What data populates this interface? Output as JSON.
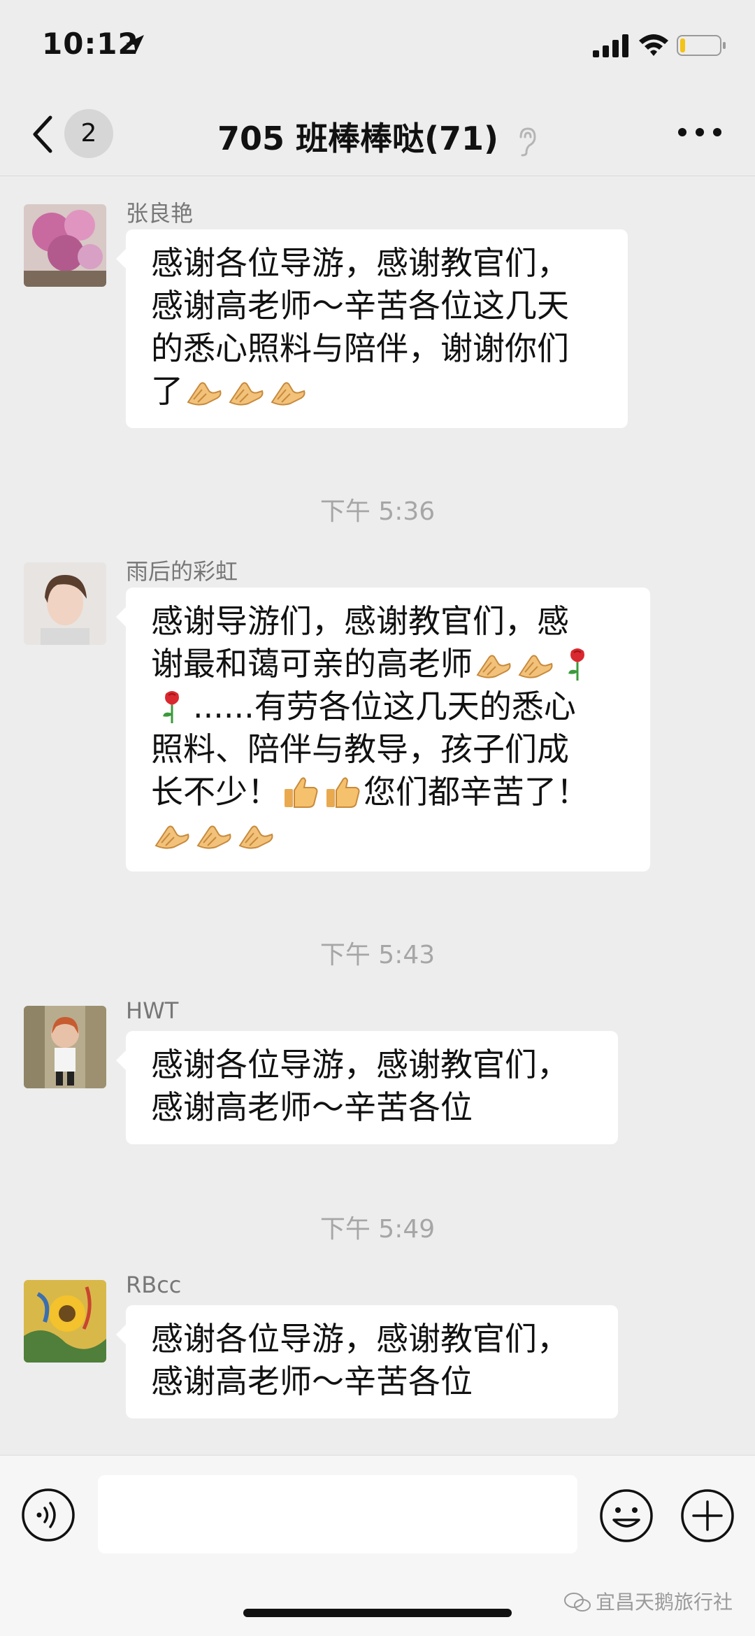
{
  "status_bar": {
    "time": "10:12"
  },
  "nav": {
    "back_count": "2",
    "title": "705 班棒棒哒(71)"
  },
  "messages": [
    {
      "sender": "张良艳",
      "lines": [
        "感谢各位导游，感谢教官们，",
        "感谢高老师～辛苦各位这几天",
        "的悉心照料与陪伴，谢谢你们",
        "了"
      ]
    },
    {
      "timestamp": "下午 5:36"
    },
    {
      "sender": "雨后的彩虹",
      "lines": [
        "感谢导游们，感谢教官们，感",
        "谢最和蔼可亲的高老师",
        "......有劳各位这几天的悉心",
        "照料、陪伴与教导，孩子们成",
        "长不少！",
        "您们都辛苦了！"
      ]
    },
    {
      "timestamp": "下午 5:43"
    },
    {
      "sender": "HWT",
      "lines": [
        "感谢各位导游，感谢教官们，",
        "感谢高老师～辛苦各位"
      ]
    },
    {
      "timestamp": "下午 5:49"
    },
    {
      "sender": "RBcc",
      "lines": [
        "感谢各位导游，感谢教官们，",
        "感谢高老师～辛苦各位"
      ]
    }
  ],
  "footer": {
    "watermark": "宜昌天鹅旅行社"
  },
  "colors": {
    "background": "#ededed",
    "bubble": "#ffffff",
    "timestamp": "#a6a6a6",
    "sender": "#777777"
  }
}
